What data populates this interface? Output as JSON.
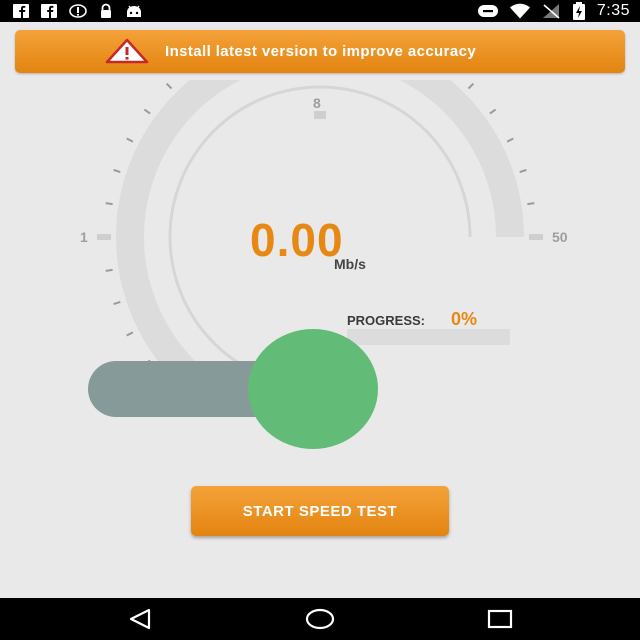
{
  "status_bar": {
    "time": "7:35",
    "left_icons": [
      "facebook-icon",
      "facebook-icon",
      "sync-icon",
      "lock-icon",
      "android-icon"
    ],
    "right_icons": [
      "do-not-disturb-icon",
      "wifi-icon",
      "no-signal-icon",
      "battery-charging-icon"
    ]
  },
  "banner": {
    "icon": "warning-icon",
    "text": "Install latest version to improve accuracy"
  },
  "gauge": {
    "speed": "0.00",
    "unit": "Mb/s",
    "min_label": "1",
    "max_label": "50",
    "top_label": "8"
  },
  "progress": {
    "label": "PROGRESS:",
    "value": "0%",
    "fraction": 0
  },
  "toggle": {
    "state": "on"
  },
  "start_button": {
    "label": "START SPEED TEST"
  },
  "nav_bar": {
    "icons": [
      "back-icon",
      "home-icon",
      "recents-icon"
    ]
  },
  "colors": {
    "accent": "#e68813",
    "toggle_knob": "#62bb76",
    "toggle_track": "#869a9a"
  }
}
